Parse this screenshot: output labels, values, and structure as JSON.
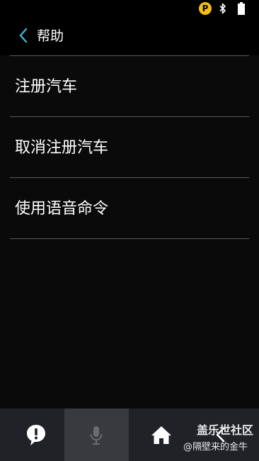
{
  "status_bar": {
    "p_badge": "P",
    "icons": [
      "p-icon",
      "bluetooth-icon",
      "battery-icon"
    ]
  },
  "header": {
    "back_icon": "chevron-left-icon",
    "title": "帮助",
    "accent_color": "#3fb6d8"
  },
  "menu": {
    "items": [
      {
        "label": "注册汽车"
      },
      {
        "label": "取消注册汽车"
      },
      {
        "label": "使用语音命令"
      }
    ]
  },
  "bottom_nav": {
    "buttons": [
      {
        "icon": "feedback-icon"
      },
      {
        "icon": "microphone-icon",
        "state": "disabled"
      },
      {
        "icon": "home-icon"
      },
      {
        "icon": "back-icon"
      }
    ]
  },
  "watermark": {
    "title": "盖乐世社区",
    "user": "@隔壁来的金牛"
  }
}
